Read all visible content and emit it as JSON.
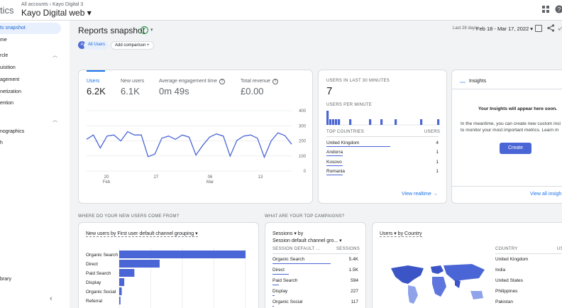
{
  "header": {
    "brand_fragment": "tics",
    "breadcrumb": "All accounts  ›  Kayo Digital 3",
    "property": "Kayo Digital web ▾",
    "apps_icon": "apps-grid-icon",
    "help_icon": "help-icon"
  },
  "sidebar": {
    "items": [
      {
        "label": "ts snapshot",
        "active": true
      },
      {
        "label": "me"
      },
      {
        "label": "rcle"
      },
      {
        "label": "uisition"
      },
      {
        "label": "agement"
      },
      {
        "label": "netization"
      },
      {
        "label": "ention"
      },
      {
        "label": "nographics"
      },
      {
        "label": "h"
      },
      {
        "label": "brary"
      }
    ],
    "collapse_icon": "chevron-left-icon"
  },
  "page": {
    "title": "Reports snapshot",
    "status_icon": "check-circle-icon",
    "dropdown": "▾",
    "all_users_avatar": "A",
    "all_users_label": "All Users",
    "add_comparison": "Add comparison",
    "date_prefix": "Last 28 days",
    "date_range": "Feb 18 - Mar 17, 2022 ▾"
  },
  "metrics": [
    {
      "label": "Users",
      "value": "6.2K",
      "active": true,
      "help": false
    },
    {
      "label": "New users",
      "value": "6.1K",
      "active": false,
      "help": false
    },
    {
      "label": "Average engagement time",
      "value": "0m 49s",
      "active": false,
      "help": true
    },
    {
      "label": "Total revenue",
      "value": "£0.00",
      "active": false,
      "help": true
    }
  ],
  "users_chart": {
    "y_ticks": [
      "400",
      "300",
      "200",
      "100",
      "0"
    ],
    "x_ticks": [
      {
        "day": "20",
        "month": "Feb"
      },
      {
        "day": "27",
        "month": ""
      },
      {
        "day": "06",
        "month": "Mar"
      },
      {
        "day": "13",
        "month": ""
      }
    ]
  },
  "realtime": {
    "title": "USERS IN LAST 30 MINUTES",
    "count": "7",
    "per_minute_label": "USERS PER MINUTE",
    "countries_header": "TOP COUNTRIES",
    "users_header": "USERS",
    "rows": [
      {
        "country": "United Kingdom",
        "users": "4",
        "share": 1.0
      },
      {
        "country": "Andorra",
        "users": "1",
        "share": 0.25
      },
      {
        "country": "Kosovo",
        "users": "1",
        "share": 0.25
      },
      {
        "country": "Romania",
        "users": "1",
        "share": 0.25
      }
    ],
    "view_link": "View realtime →"
  },
  "insights": {
    "title": "Insights",
    "headline": "Your Insights will appear here soon.",
    "body1": "In the meantime, you can create new custom insi",
    "body2": "to monitor your most important metrics. Learn m",
    "create_button": "Create",
    "view_link": "View all insigh"
  },
  "new_users_section": {
    "title": "WHERE DO YOUR NEW USERS COME FROM?",
    "selector": "New users by First user default channel grouping ▾",
    "bars": [
      {
        "label": "Organic Search",
        "value": 100
      },
      {
        "label": "Direct",
        "value": 32
      },
      {
        "label": "Paid Search",
        "value": 12
      },
      {
        "label": "Display",
        "value": 4
      },
      {
        "label": "Organic Social",
        "value": 2
      },
      {
        "label": "Referral",
        "value": 1
      }
    ]
  },
  "campaigns_section": {
    "title": "WHAT ARE YOUR TOP CAMPAIGNS?",
    "selector_line1": "Sessions ▾  by",
    "selector_line2": "Session default channel gro... ▾",
    "col1": "SESSION DEFAULT ...",
    "col2": "SESSIONS",
    "rows": [
      {
        "label": "Organic Search",
        "value": "5.4K",
        "share": 1.0
      },
      {
        "label": "Direct",
        "value": "1.5K",
        "share": 0.28
      },
      {
        "label": "Paid Search",
        "value": "594",
        "share": 0.11
      },
      {
        "label": "Display",
        "value": "227",
        "share": 0.04
      },
      {
        "label": "Organic Social",
        "value": "117",
        "share": 0.02
      }
    ]
  },
  "country_section": {
    "selector": "Users ▾  by Country",
    "col1": "COUNTRY",
    "col2": "US",
    "rows": [
      "United Kingdom",
      "India",
      "United States",
      "Philippines",
      "Pakistan"
    ]
  }
}
